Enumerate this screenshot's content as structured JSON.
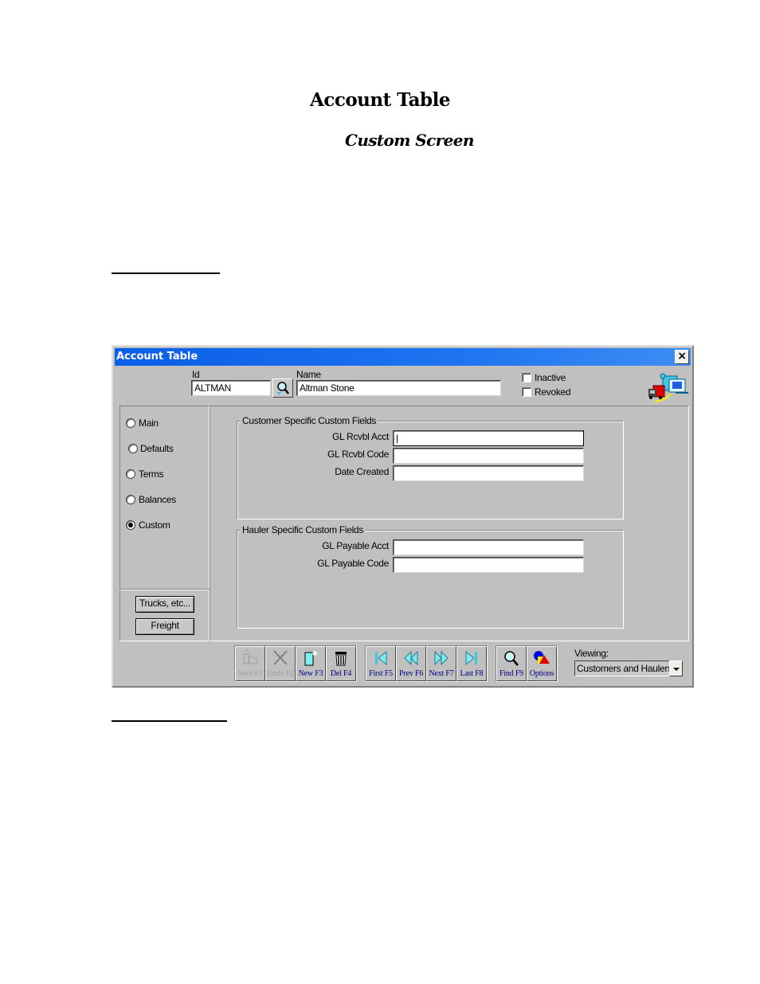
{
  "document": {
    "title": "Account Table",
    "subtitle": "Custom Screen"
  },
  "window": {
    "title": "Account Table",
    "close_icon": "close-icon"
  },
  "header": {
    "id_label": "Id",
    "id_value": "ALTMAN",
    "search_icon": "magnifier-icon",
    "name_label": "Name",
    "name_value": "Altman Stone",
    "inactive_label": "Inactive",
    "inactive_checked": false,
    "revoked_label": "Revoked",
    "revoked_checked": false,
    "app_icon": "truck-documents-icon"
  },
  "sidebar": {
    "options": [
      {
        "label": "Main",
        "selected": false
      },
      {
        "label": "Defaults",
        "selected": false
      },
      {
        "label": "Terms",
        "selected": false
      },
      {
        "label": "Balances",
        "selected": false
      },
      {
        "label": "Custom",
        "selected": true
      }
    ],
    "buttons": [
      {
        "label": "Trucks, etc..."
      },
      {
        "label": "Freight"
      }
    ]
  },
  "customer_group": {
    "title": "Customer Specific Custom Fields",
    "fields": [
      {
        "label": "GL Rcvbl Acct",
        "value": "|"
      },
      {
        "label": "GL Rcvbl Code",
        "value": ""
      },
      {
        "label": "Date Created",
        "value": ""
      }
    ]
  },
  "hauler_group": {
    "title": "Hauler Specific Custom Fields",
    "fields": [
      {
        "label": "GL Payable Acct",
        "value": ""
      },
      {
        "label": "GL Payable Code",
        "value": ""
      }
    ]
  },
  "toolbar": {
    "edit_buttons": [
      {
        "label": "Save F1",
        "icon": "save-folder-icon",
        "enabled": false
      },
      {
        "label": "Undo F2",
        "icon": "undo-x-icon",
        "enabled": false
      },
      {
        "label": "New F3",
        "icon": "new-document-icon",
        "enabled": true
      },
      {
        "label": "Del F4",
        "icon": "trash-icon",
        "enabled": true
      }
    ],
    "nav_buttons": [
      {
        "label": "First F5",
        "icon": "first-record-icon",
        "enabled": true
      },
      {
        "label": "Prev F6",
        "icon": "previous-record-icon",
        "enabled": true
      },
      {
        "label": "Next F7",
        "icon": "next-record-icon",
        "enabled": true
      },
      {
        "label": "Last F8",
        "icon": "last-record-icon",
        "enabled": true
      }
    ],
    "tool_buttons": [
      {
        "label": "Find F9",
        "icon": "find-magnifier-icon",
        "enabled": true
      },
      {
        "label": "Options",
        "icon": "options-shapes-icon",
        "enabled": true
      }
    ]
  },
  "viewing": {
    "label": "Viewing:",
    "selected": "Customers and Haulers"
  },
  "colors": {
    "titlebar": "#0a5ee8",
    "window_bg": "#c0c0c0",
    "toolbar_label": "#000080"
  }
}
